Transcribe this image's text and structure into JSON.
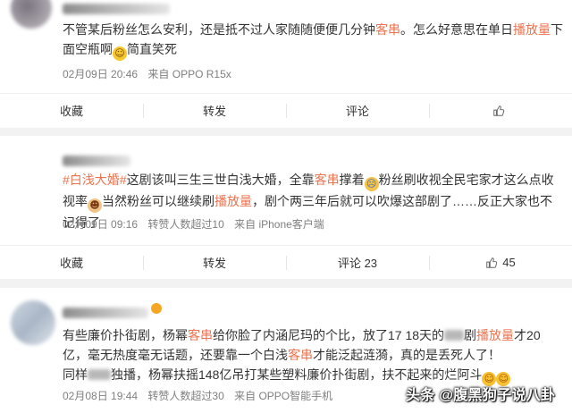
{
  "posts": [
    {
      "segments": [
        {
          "t": "不管某后粉丝怎么安利，还是抵不过人家随随便便几分钟"
        },
        {
          "t": "客串",
          "hl": true
        },
        {
          "t": "。怎么好意思在单日"
        },
        {
          "t": "播放量",
          "hl": true
        },
        {
          "t": "下面空瓶啊"
        },
        {
          "emoji": "laugh"
        },
        {
          "t": "简直笑死"
        }
      ],
      "time": "02月09日 20:46",
      "source": "来自 OPPO R15x",
      "actions": {
        "collect": "收藏",
        "share": "转发",
        "comment": "评论",
        "like": ""
      }
    },
    {
      "segments": [
        {
          "t": "#白浅大婚#",
          "hl": true
        },
        {
          "t": "这剧该叫三生三世白浅大婚，全靠"
        },
        {
          "t": "客串",
          "hl": true
        },
        {
          "t": "撑着"
        },
        {
          "emoji": "sweat"
        },
        {
          "t": "粉丝刷收视全民宅家才这么点收视率"
        },
        {
          "emoji": "cute"
        },
        {
          "t": "当然粉丝可以继续刷"
        },
        {
          "t": "播放量",
          "hl": true
        },
        {
          "t": "，剧个两三年后就可以吹爆这部剧了……反正大家也不记得了"
        }
      ],
      "time": "02月09日 09:16",
      "repost_note": "转赞人数超过10",
      "source": "来自 iPhone客户端",
      "actions": {
        "collect": "收藏",
        "share": "转发",
        "comment": "评论 23",
        "like": "45"
      }
    },
    {
      "segments": [
        {
          "t": "有些廉价扑街剧，杨幂"
        },
        {
          "t": "客串",
          "hl": true
        },
        {
          "t": "给你脸了内涵尼玛的个比，放了17 18天的"
        },
        {
          "blur": 22
        },
        {
          "t": "剧"
        },
        {
          "t": "播放量",
          "hl": true
        },
        {
          "t": "才20亿，毫无热度毫无话题，还要靠一个白浅"
        },
        {
          "t": "客串",
          "hl": true
        },
        {
          "t": "才能泛起涟漪，真的是丢死人了！"
        },
        {
          "br": true
        },
        {
          "t": "同样"
        },
        {
          "blur": 26
        },
        {
          "t": "独播，杨幂扶摇148亿吊打某些塑料廉价扑街剧，扶不起来的烂阿斗"
        },
        {
          "emoji": "grin"
        },
        {
          "emoji": "grin"
        }
      ],
      "time": "02月08日 19:44",
      "repost_note": "转赞人数超过30",
      "source": "来自 OPPO智能手机"
    }
  ],
  "watermark": "头条 @腹黑狗子说八卦",
  "colors": {
    "highlight": "#eb7350",
    "meta": "#808080",
    "background": "#f2f2f2"
  }
}
